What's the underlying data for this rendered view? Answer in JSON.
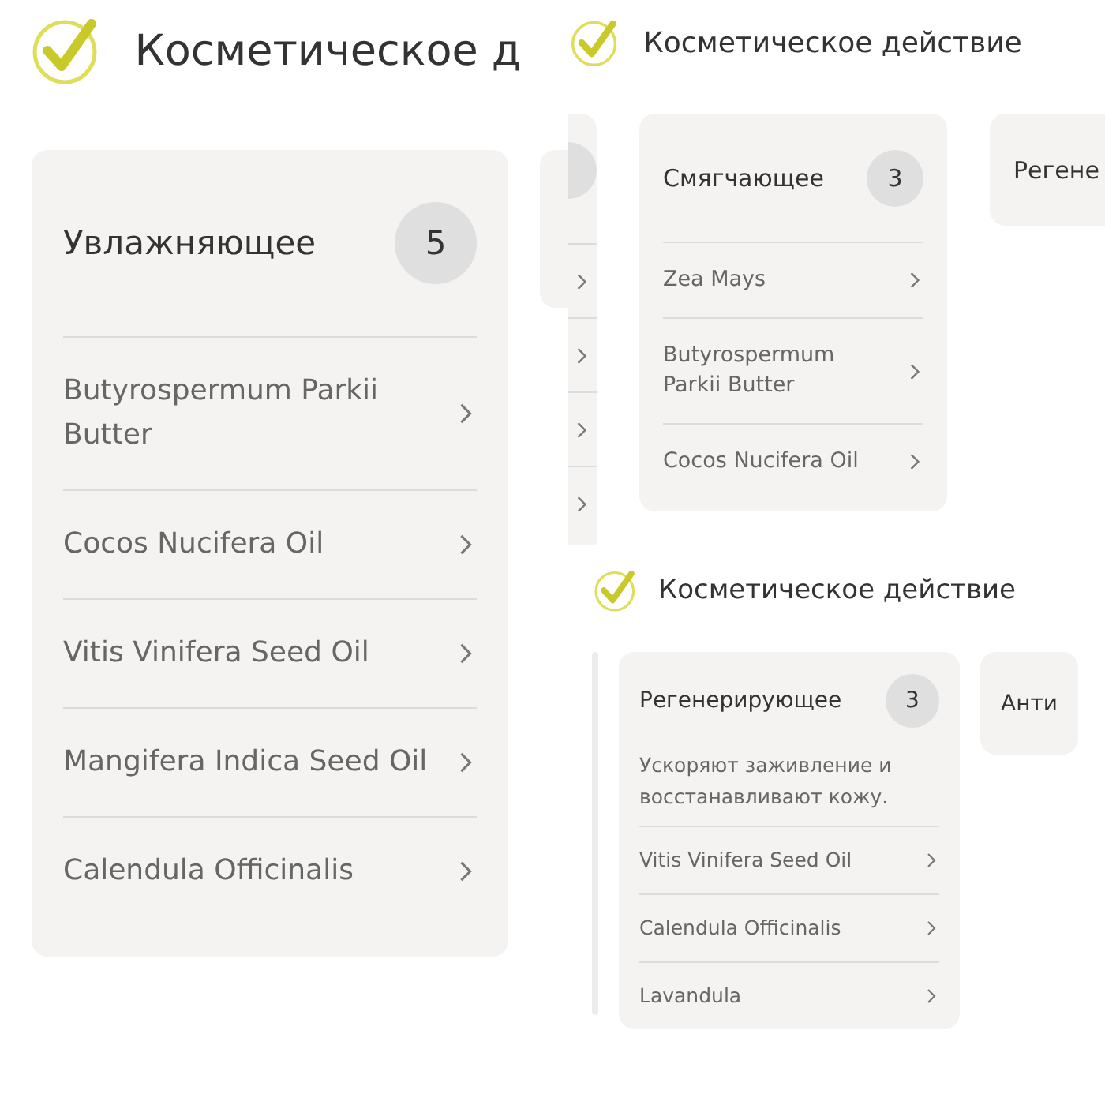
{
  "panels": [
    {
      "title": "Косметическое д",
      "cards": [
        {
          "kind": "full",
          "title": "Увлажняющее",
          "count": "5",
          "items": [
            {
              "label": "Butyrospermum Parkii Butter"
            },
            {
              "label": "Cocos Nucifera Oil"
            },
            {
              "label": "Vitis Vinifera Seed Oil"
            },
            {
              "label": "Mangifera Indica Seed Oil"
            },
            {
              "label": "Calendula Officinalis"
            }
          ]
        },
        {
          "kind": "edge"
        }
      ]
    },
    {
      "title": "Косметическое действие",
      "cards": [
        {
          "kind": "edge",
          "badge": true,
          "rows": [
            {
              "kind": "link"
            },
            {
              "kind": "link"
            },
            {
              "kind": "link"
            },
            {
              "kind": "link"
            }
          ]
        },
        {
          "kind": "full",
          "title": "Смягчающее",
          "count": "3",
          "items": [
            {
              "label": "Zea Mays"
            },
            {
              "label": "Butyrospermum Parkii Butter"
            },
            {
              "label": "Cocos Nucifera Oil"
            }
          ]
        },
        {
          "kind": "full",
          "title": "Регене"
        }
      ]
    },
    {
      "title": "Косметическое действие",
      "cards": [
        {
          "kind": "edge"
        },
        {
          "kind": "full",
          "title": "Регенерирующее",
          "count": "3",
          "description": "Ускоряют заживление и восстанавливают кожу.",
          "items": [
            {
              "label": "Vitis Vinifera Seed Oil"
            },
            {
              "label": "Calendula Officinalis"
            },
            {
              "label": "Lavandula"
            }
          ]
        },
        {
          "kind": "full",
          "title": "Анти"
        }
      ]
    }
  ]
}
